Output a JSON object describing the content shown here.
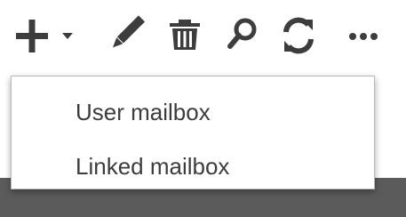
{
  "toolbar": {
    "buttons": [
      {
        "name": "new",
        "icon": "plus-icon",
        "has_dropdown": true
      },
      {
        "name": "edit",
        "icon": "pencil-icon"
      },
      {
        "name": "delete",
        "icon": "trash-icon"
      },
      {
        "name": "search",
        "icon": "search-icon"
      },
      {
        "name": "refresh",
        "icon": "refresh-icon"
      },
      {
        "name": "more",
        "icon": "ellipsis-icon"
      }
    ],
    "icon_color": "#3d3d3d"
  },
  "new_menu": {
    "items": [
      {
        "label": "User mailbox"
      },
      {
        "label": "Linked mailbox"
      }
    ]
  }
}
